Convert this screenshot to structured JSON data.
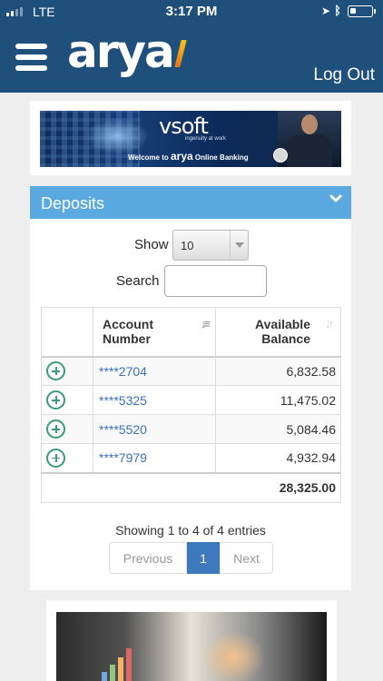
{
  "status_bar": {
    "carrier": "LTE",
    "time": "3:17 PM"
  },
  "header": {
    "logo": "arya",
    "logout": "Log Out"
  },
  "banner": {
    "brand": "vsoft",
    "tagline": "ingenuity at work",
    "welcome_prefix": "Welcome to",
    "welcome_brand": "arya",
    "welcome_suffix": "Online Banking"
  },
  "deposits": {
    "title": "Deposits",
    "show_label": "Show",
    "show_value": "10",
    "search_label": "Search",
    "search_value": "",
    "columns": {
      "account_line1": "Account",
      "account_line2": "Number",
      "balance_line1": "Available",
      "balance_line2": "Balance"
    },
    "rows": [
      {
        "account": "****2704",
        "balance": "6,832.58"
      },
      {
        "account": "****5325",
        "balance": "11,475.02"
      },
      {
        "account": "****5520",
        "balance": "5,084.46"
      },
      {
        "account": "****7979",
        "balance": "4,932.94"
      }
    ],
    "total": "28,325.00",
    "info": "Showing 1 to 4 of 4 entries",
    "pagination": {
      "previous": "Previous",
      "current": "1",
      "next": "Next"
    }
  },
  "colors": {
    "header": "#1f4f7b",
    "panel_header": "#5aa9e0",
    "link": "#3a72b8",
    "expand_icon": "#3d9a78",
    "active_page": "#3f79bd"
  }
}
